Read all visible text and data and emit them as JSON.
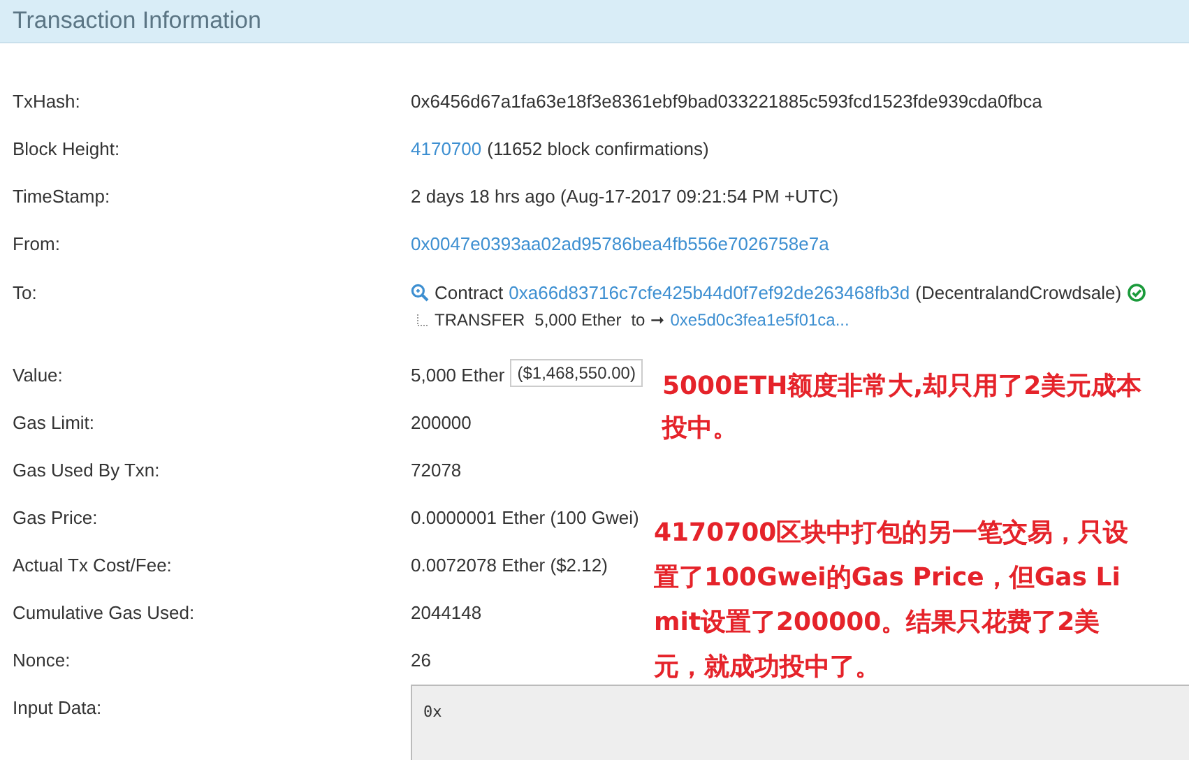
{
  "header": {
    "title": "Transaction Information"
  },
  "rows": [
    {
      "label": "TxHash:",
      "kind": "plain",
      "parts": [
        {
          "kind": "text",
          "text": "0x6456d67a1fa63e18f3e8361ebf9bad033221885c593fcd1523fde939cda0fbca"
        }
      ]
    },
    {
      "label": "Block Height:",
      "kind": "plain",
      "parts": [
        {
          "kind": "link",
          "text": "4170700"
        },
        {
          "kind": "text",
          "text": "(11652 block confirmations)"
        }
      ]
    },
    {
      "label": "TimeStamp:",
      "kind": "plain",
      "parts": [
        {
          "kind": "text",
          "text": "2 days 18 hrs ago (Aug-17-2017 09:21:54 PM +UTC)"
        }
      ]
    },
    {
      "label": "From:",
      "kind": "plain",
      "parts": [
        {
          "kind": "link",
          "text": "0x0047e0393aa02ad95786bea4fb556e7026758e7a"
        }
      ]
    },
    {
      "label": "To:",
      "kind": "contract",
      "contract": {
        "prefix": "Contract",
        "address": "0xa66d83716c7cfe425b44d0f7ef92de263468fb3d",
        "name": "(DecentralandCrowdsale)",
        "verified": true
      },
      "transfer": {
        "action": "TRANSFER",
        "amount": "5,000 Ether",
        "to": "to",
        "arrow": "➞",
        "address": "0xe5d0c3fea1e5f01ca..."
      }
    },
    {
      "label": "Value:",
      "kind": "plain",
      "parts": [
        {
          "kind": "text",
          "text": "5,000 Ether"
        },
        {
          "kind": "badge",
          "text": "($1,468,550.00)"
        }
      ]
    },
    {
      "label": "Gas Limit:",
      "kind": "plain",
      "parts": [
        {
          "kind": "text",
          "text": "200000"
        }
      ]
    },
    {
      "label": "Gas Used By Txn:",
      "kind": "plain",
      "parts": [
        {
          "kind": "text",
          "text": "72078"
        }
      ]
    },
    {
      "label": "Gas Price:",
      "kind": "plain",
      "parts": [
        {
          "kind": "text",
          "text": "0.0000001 Ether (100 Gwei)"
        }
      ]
    },
    {
      "label": "Actual Tx Cost/Fee:",
      "kind": "plain",
      "parts": [
        {
          "kind": "text",
          "text": "0.0072078 Ether ($2.12)"
        }
      ]
    },
    {
      "label": "Cumulative Gas Used:",
      "kind": "plain",
      "parts": [
        {
          "kind": "text",
          "text": "2044148"
        }
      ]
    },
    {
      "label": "Nonce:",
      "kind": "plain",
      "parts": [
        {
          "kind": "text",
          "text": "26"
        }
      ]
    },
    {
      "label": "Input Data:",
      "kind": "input",
      "value": "0x"
    }
  ],
  "annotations": [
    {
      "text": "5000ETH额度非常大,却只用了2美元成本投中。"
    },
    {
      "text": "4170700区块中打包的另一笔交易，只设置了100Gwei的Gas Price，但Gas Limit设置了200000。结果只花费了2美元，就成功投中了。"
    }
  ]
}
